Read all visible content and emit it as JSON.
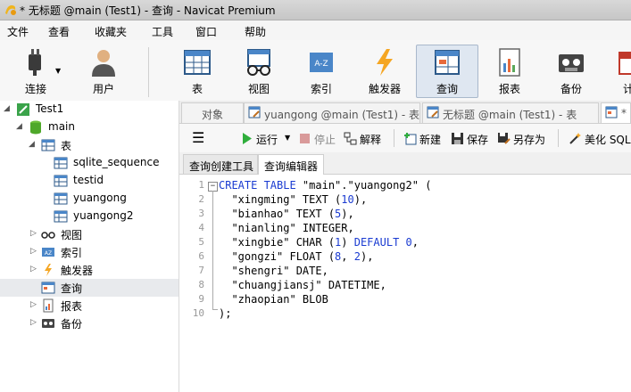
{
  "window": {
    "title": "* 无标题 @main (Test1) - 查询 - Navicat Premium"
  },
  "menu": [
    "文件",
    "查看",
    "收藏夹",
    "工具",
    "窗口",
    "帮助"
  ],
  "toolbar": {
    "connect": "连接",
    "user": "用户",
    "table": "表",
    "view": "视图",
    "index": "索引",
    "trigger": "触发器",
    "query": "查询",
    "report": "报表",
    "backup": "备份",
    "more": "计"
  },
  "tree": {
    "connection": "Test1",
    "database": "main",
    "tables_folder": "表",
    "tables": [
      "sqlite_sequence",
      "testid",
      "yuangong",
      "yuangong2"
    ],
    "views": "视图",
    "indexes": "索引",
    "triggers": "触发器",
    "queries": "查询",
    "reports": "报表",
    "backups": "备份"
  },
  "tabs": {
    "objects": "对象",
    "tab1": "yuangong @main (Test1) - 表",
    "tab2": "无标题 @main (Test1) - 表",
    "tab3": "*"
  },
  "query_toolbar": {
    "run": "运行",
    "stop": "停止",
    "explain": "解释",
    "new": "新建",
    "save": "保存",
    "save_as": "另存为",
    "beautify": "美化 SQL"
  },
  "subtabs": {
    "builder": "查询创建工具",
    "editor": "查询编辑器"
  },
  "editor": {
    "line_numbers": [
      "1",
      "2",
      "3",
      "4",
      "5",
      "6",
      "7",
      "8",
      "9",
      "10"
    ],
    "lines": [
      [
        {
          "t": "CREATE TABLE ",
          "c": "kw"
        },
        {
          "t": "\"main\".\"yuangong2\" (",
          "c": "str"
        }
      ],
      [
        {
          "t": "  \"xingming\" TEXT (",
          "c": "str"
        },
        {
          "t": "10",
          "c": "nm"
        },
        {
          "t": "),",
          "c": "str"
        }
      ],
      [
        {
          "t": "  \"bianhao\" TEXT (",
          "c": "str"
        },
        {
          "t": "5",
          "c": "nm"
        },
        {
          "t": "),",
          "c": "str"
        }
      ],
      [
        {
          "t": "  \"nianling\" INTEGER,",
          "c": "str"
        }
      ],
      [
        {
          "t": "  \"xingbie\" CHAR (",
          "c": "str"
        },
        {
          "t": "1",
          "c": "nm"
        },
        {
          "t": ") ",
          "c": "str"
        },
        {
          "t": "DEFAULT ",
          "c": "kw"
        },
        {
          "t": "0",
          "c": "nm"
        },
        {
          "t": ",",
          "c": "str"
        }
      ],
      [
        {
          "t": "  \"gongzi\" FLOAT (",
          "c": "str"
        },
        {
          "t": "8",
          "c": "nm"
        },
        {
          "t": ", ",
          "c": "str"
        },
        {
          "t": "2",
          "c": "nm"
        },
        {
          "t": "),",
          "c": "str"
        }
      ],
      [
        {
          "t": "  \"shengri\" DATE,",
          "c": "str"
        }
      ],
      [
        {
          "t": "  \"chuangjiansj\" DATETIME,",
          "c": "str"
        }
      ],
      [
        {
          "t": "  \"zhaopian\" BLOB",
          "c": "str"
        }
      ],
      [
        {
          "t": ");",
          "c": "str"
        }
      ]
    ]
  }
}
